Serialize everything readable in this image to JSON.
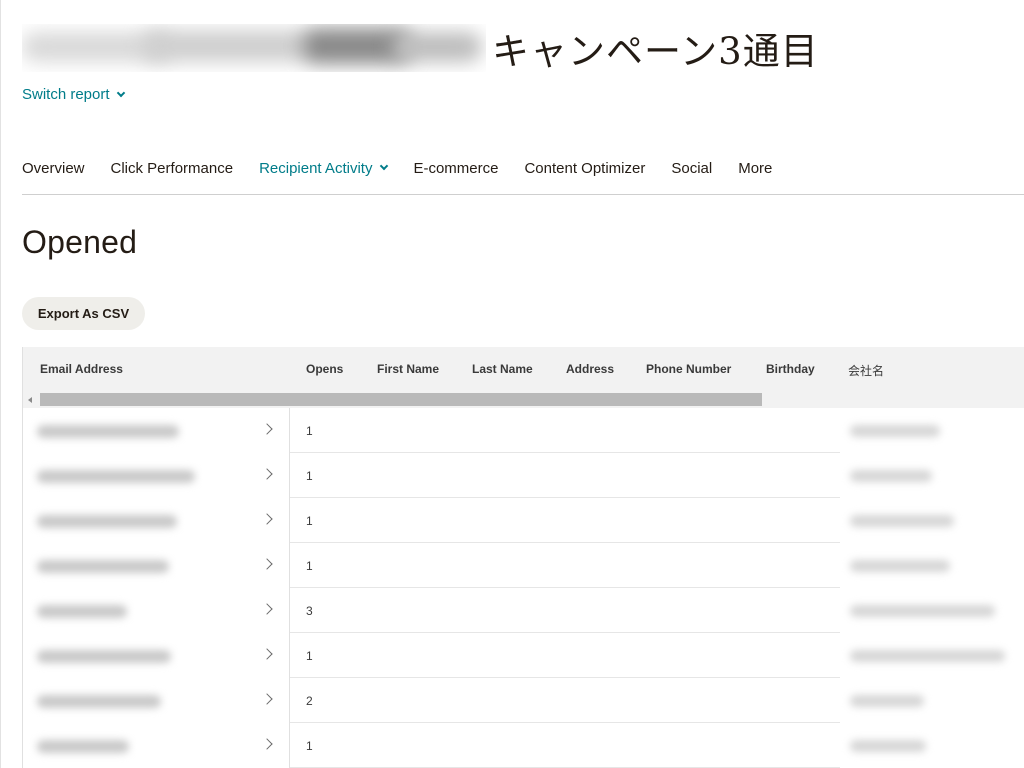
{
  "header": {
    "campaign_suffix": "キャンペーン3通目",
    "switch_report_label": "Switch report"
  },
  "tabs": [
    {
      "label": "Overview",
      "active": false
    },
    {
      "label": "Click Performance",
      "active": false
    },
    {
      "label": "Recipient Activity",
      "active": true,
      "has_dropdown": true
    },
    {
      "label": "E-commerce",
      "active": false
    },
    {
      "label": "Content Optimizer",
      "active": false
    },
    {
      "label": "Social",
      "active": false
    },
    {
      "label": "More",
      "active": false
    }
  ],
  "page": {
    "title": "Opened",
    "export_label": "Export As CSV"
  },
  "table": {
    "columns": [
      "Email Address",
      "Opens",
      "First Name",
      "Last Name",
      "Address",
      "Phone Number",
      "Birthday",
      "会社名"
    ],
    "rows": [
      {
        "opens": "1"
      },
      {
        "opens": "1"
      },
      {
        "opens": "1"
      },
      {
        "opens": "1"
      },
      {
        "opens": "3"
      },
      {
        "opens": "1"
      },
      {
        "opens": "2"
      },
      {
        "opens": "1"
      }
    ]
  },
  "colors": {
    "accent": "#007c89",
    "text": "#241c15",
    "header_bg": "#f2f2f2",
    "button_bg": "#efeeea"
  },
  "icons": {
    "switch_report": "chevron-down-icon",
    "tab_dropdown": "chevron-down-icon",
    "row_expand": "chevron-right-icon",
    "scroll_left": "arrow-left-icon"
  }
}
